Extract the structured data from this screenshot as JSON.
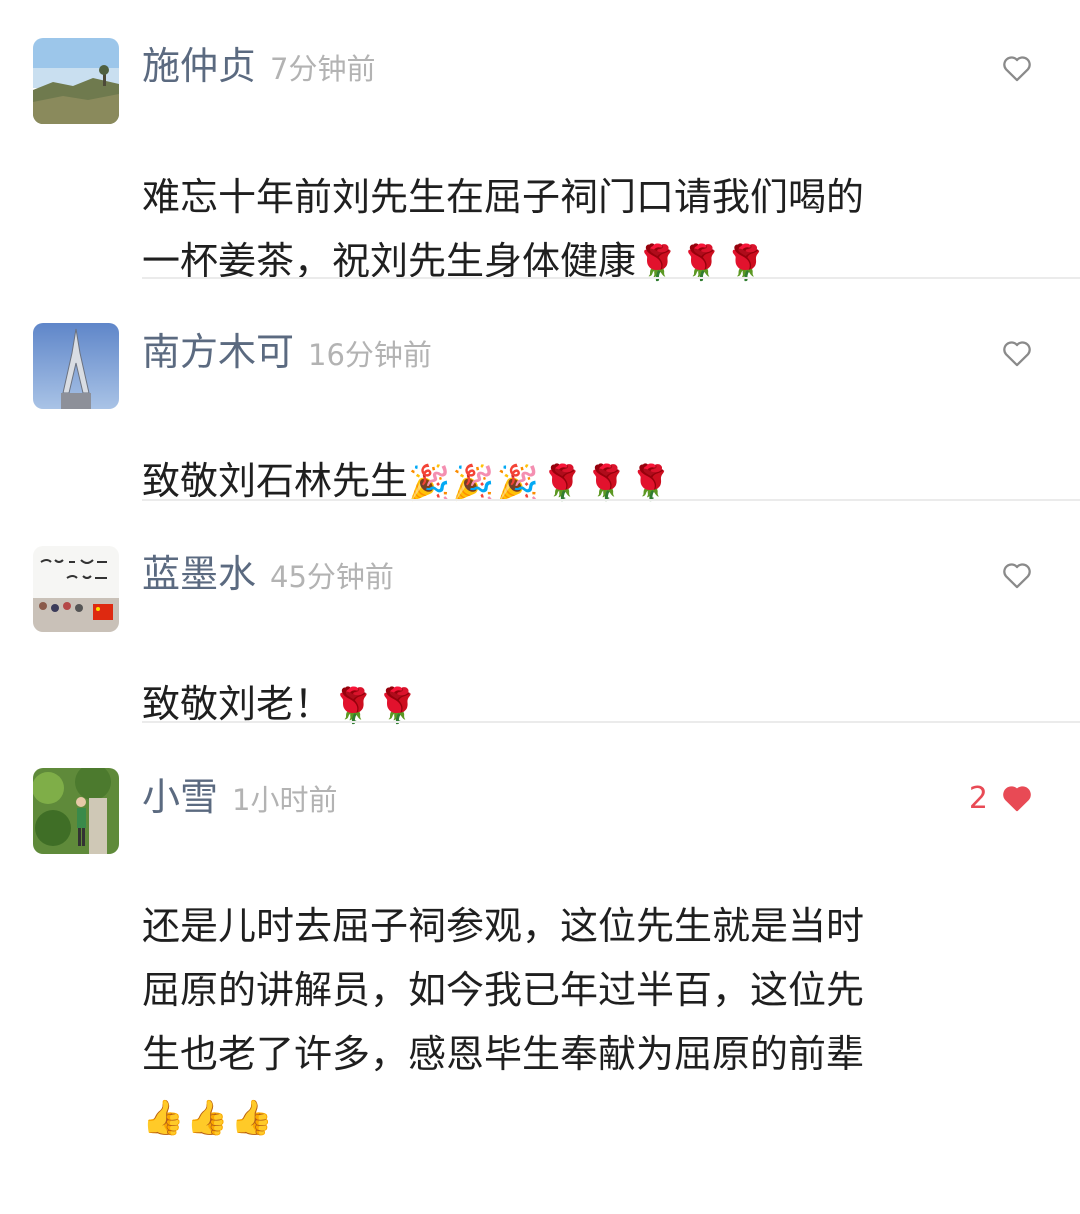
{
  "comments": [
    {
      "name": "施仲贞",
      "time": "7分钟前",
      "text": "难忘十年前刘先生在屈子祠门口请我们喝的\n一杯姜茶，祝刘先生身体健康",
      "emojis": "🌹🌹🌹",
      "likes": "",
      "liked": false,
      "avatar_icon": "mountain-landscape-avatar"
    },
    {
      "name": "南方木可",
      "time": "16分钟前",
      "text": "致敬刘石林先生",
      "emojis": "🎉🎉🎉🌹🌹🌹",
      "likes": "",
      "liked": false,
      "avatar_icon": "statue-sky-avatar"
    },
    {
      "name": "蓝墨水",
      "time": "45分钟前",
      "text": "致敬刘老！",
      "emojis": "🌹🌹",
      "likes": "",
      "liked": false,
      "avatar_icon": "calligraphy-crowd-avatar"
    },
    {
      "name": "小雪",
      "time": "1小时前",
      "text": "还是儿时去屈子祠参观，这位先生就是当时\n屈原的讲解员，如今我已年过半百，这位先\n生也老了许多，感恩毕生奉献为屈原的前辈",
      "emojis": "👍👍👍",
      "likes": "2",
      "liked": true,
      "avatar_icon": "garden-person-avatar"
    }
  ],
  "colors": {
    "name": "#5b6a80",
    "time": "#b3b3b3",
    "text": "#1f1f1f",
    "heart_outline": "#8a8a8a",
    "heart_liked": "#e84a55",
    "divider": "#ebebeb"
  }
}
